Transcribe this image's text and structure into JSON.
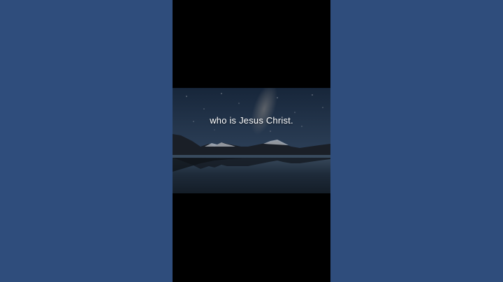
{
  "video": {
    "caption": "who is Jesus Christ."
  },
  "colors": {
    "side_background": "#2f4d7c",
    "letterbox": "#000000",
    "sky_top": "#1a2a3f",
    "sky_bottom": "#3a5068",
    "caption_text": "#ffffff"
  },
  "icons": {
    "scene": "night-mountain-lake-image"
  }
}
